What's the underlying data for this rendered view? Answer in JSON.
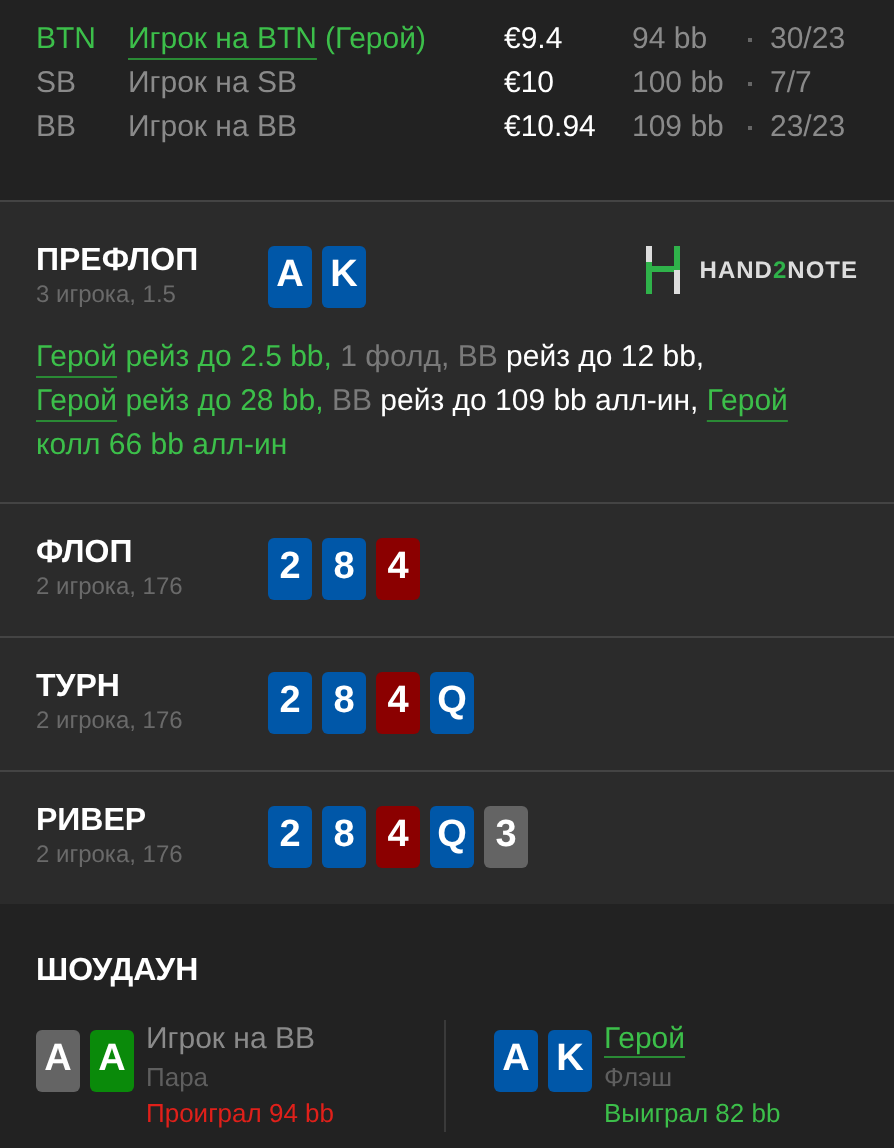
{
  "players": [
    {
      "position": "BTN",
      "name": "Игрок на BTN",
      "hero_tag": "(Герой)",
      "hero": true,
      "stack": "€9.4",
      "bb": "94 bb",
      "hands": "30/23"
    },
    {
      "position": "SB",
      "name": "Игрок на SB",
      "hero": false,
      "stack": "€10",
      "bb": "100 bb",
      "hands": "7/7"
    },
    {
      "position": "BB",
      "name": "Игрок на BB",
      "hero": false,
      "stack": "€10.94",
      "bb": "109 bb",
      "hands": "23/23"
    }
  ],
  "streets": [
    {
      "name": "ПРЕФЛОП",
      "info": "3 игрока, 1.5",
      "cards": [
        {
          "rank": "A",
          "color": "#0057a8"
        },
        {
          "rank": "K",
          "color": "#0057a8"
        }
      ],
      "logo": {
        "prefix": "HAND",
        "accent": "2",
        "suffix": "NOTE"
      },
      "actions": [
        {
          "kind": "hero_link",
          "text": "Герой"
        },
        {
          "kind": "hero",
          "text": " рейз до 2.5 bb,"
        },
        {
          "kind": "muted",
          "text": " 1 фолд, ВВ"
        },
        {
          "kind": "villain",
          "text": " рейз до 12 bb, "
        },
        {
          "kind": "hero_link",
          "text": "Герой"
        },
        {
          "kind": "hero",
          "text": " рейз до 28 bb,"
        },
        {
          "kind": "muted",
          "text": " ВВ"
        },
        {
          "kind": "villain",
          "text": " рейз до 109 bb алл-ин, "
        },
        {
          "kind": "hero_link",
          "text": "Герой"
        },
        {
          "kind": "hero",
          "text": " колл 66 bb алл-ин"
        }
      ]
    },
    {
      "name": "ФЛОП",
      "info": "2 игрока, 176",
      "cards": [
        {
          "rank": "2",
          "color": "#0057a8"
        },
        {
          "rank": "8",
          "color": "#0057a8"
        },
        {
          "rank": "4",
          "color": "#8b0000"
        }
      ]
    },
    {
      "name": "ТУРН",
      "info": "2 игрока, 176",
      "cards": [
        {
          "rank": "2",
          "color": "#0057a8"
        },
        {
          "rank": "8",
          "color": "#0057a8"
        },
        {
          "rank": "4",
          "color": "#8b0000"
        },
        {
          "rank": "Q",
          "color": "#0057a8"
        }
      ]
    },
    {
      "name": "РИВЕР",
      "info": "2 игрока, 176",
      "cards": [
        {
          "rank": "2",
          "color": "#0057a8"
        },
        {
          "rank": "8",
          "color": "#0057a8"
        },
        {
          "rank": "4",
          "color": "#8b0000"
        },
        {
          "rank": "Q",
          "color": "#0057a8"
        },
        {
          "rank": "3",
          "color": "#646464"
        }
      ]
    }
  ],
  "showdown": {
    "title": "ШОУДАУН",
    "players": [
      {
        "cards": [
          {
            "rank": "A",
            "color": "#646464"
          },
          {
            "rank": "A",
            "color": "#0a8a0a"
          }
        ],
        "name": "Игрок на BB",
        "hero": false,
        "hand": "Пара",
        "result": "Проиграл 94 bb",
        "won": false
      },
      {
        "cards": [
          {
            "rank": "A",
            "color": "#0057a8"
          },
          {
            "rank": "K",
            "color": "#0057a8"
          }
        ],
        "name": "Герой",
        "hero": true,
        "hand": "Флэш",
        "result": "Выиграл 82 bb",
        "won": true
      }
    ]
  }
}
